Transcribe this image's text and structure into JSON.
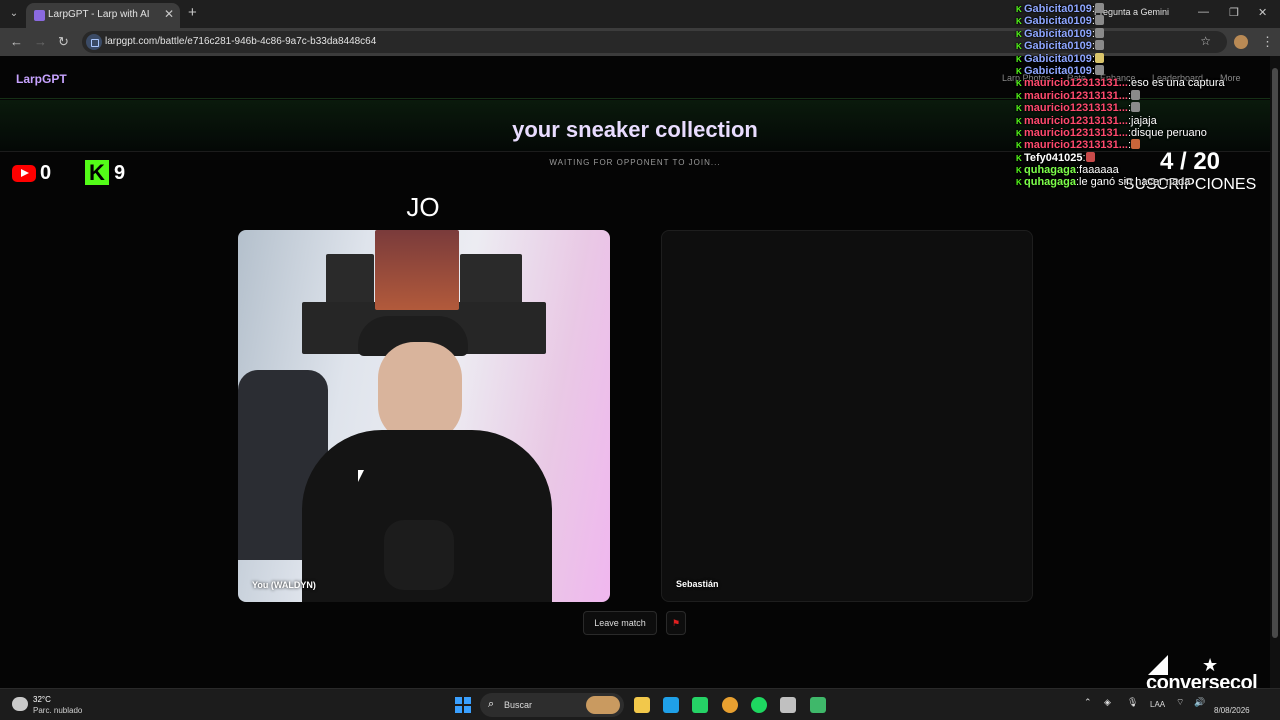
{
  "browser": {
    "tab_title": "LarpGPT - Larp with AI",
    "tab_close": "✕",
    "new_tab": "+",
    "url": "larpgpt.com/battle/e716c281-946b-4c86-9a7c-b33da8448c64",
    "gemini_label": "Pregunta a Gemini",
    "window_controls": [
      "—",
      "❐",
      "✕"
    ]
  },
  "site": {
    "brand": "LarpGPT",
    "nav": [
      "Larp Photos",
      "Rate",
      "Enhance",
      "Leaderboard",
      "More"
    ],
    "title": "your sneaker collection",
    "status": "WAITING FOR OPPONENT TO JOIN...",
    "player_label": "You (WALDYN)",
    "opponent_label": "Sebastián",
    "leave_button": "Leave match",
    "report_icon": "⚑"
  },
  "overlay": {
    "youtube_count": "0",
    "kick_letter": "K",
    "kick_count": "9",
    "big_text": "JO",
    "subs_count": "4 / 20",
    "subs_label": "SUSCRIPCIONES",
    "logo_text": "conversecol"
  },
  "chat": [
    {
      "user": "Gabicita0109",
      "msg": "",
      "user_color": "#8ea6ff",
      "emote": "#8a8a8a"
    },
    {
      "user": "Gabicita0109",
      "msg": "",
      "user_color": "#8ea6ff",
      "emote": "#8a8a8a"
    },
    {
      "user": "Gabicita0109",
      "msg": "",
      "user_color": "#8ea6ff",
      "emote": "#8a8a8a"
    },
    {
      "user": "Gabicita0109",
      "msg": "",
      "user_color": "#8ea6ff",
      "emote": "#8a8a8a"
    },
    {
      "user": "Gabicita0109",
      "msg": "",
      "user_color": "#8ea6ff",
      "emote": "#d9c46a"
    },
    {
      "user": "Gabicita0109",
      "msg": "",
      "user_color": "#8ea6ff",
      "emote": "#8a8a8a"
    },
    {
      "user": "mauricio12313131...",
      "msg": "eso es una captura",
      "user_color": "#ff4a6e",
      "emote": ""
    },
    {
      "user": "mauricio12313131...",
      "msg": "",
      "user_color": "#ff4a6e",
      "emote": "#8a8a8a"
    },
    {
      "user": "mauricio12313131...",
      "msg": "",
      "user_color": "#ff4a6e",
      "emote": "#8a8a8a"
    },
    {
      "user": "mauricio12313131...",
      "msg": "jajaja",
      "user_color": "#ff4a6e",
      "emote": ""
    },
    {
      "user": "mauricio12313131...",
      "msg": "disque peruano",
      "user_color": "#ff4a6e",
      "emote": ""
    },
    {
      "user": "mauricio12313131...",
      "msg": "",
      "user_color": "#ff4a6e",
      "emote": "#c8653a"
    },
    {
      "user": "Tefy041025",
      "msg": "",
      "user_color": "#ffffff",
      "emote": "#c84a4a"
    },
    {
      "user": "quhagaga",
      "msg": "faaaaaa",
      "user_color": "#7dff4a",
      "emote": ""
    },
    {
      "user": "quhagaga",
      "msg": "le ganó sin hacer nada",
      "user_color": "#7dff4a",
      "emote": ""
    }
  ],
  "taskbar": {
    "weather_temp": "32°C",
    "weather_desc": "Parc. nublado",
    "search_icon": "⌕",
    "search_label": "Buscar",
    "lang": "LAA",
    "time": "",
    "date": "8/08/2026",
    "app_colors": [
      "#f2c84b",
      "#1fa0e8",
      "#25d366",
      "#e8a030",
      "#1ed760",
      "#c0c0c0",
      "#3fb86a"
    ]
  }
}
